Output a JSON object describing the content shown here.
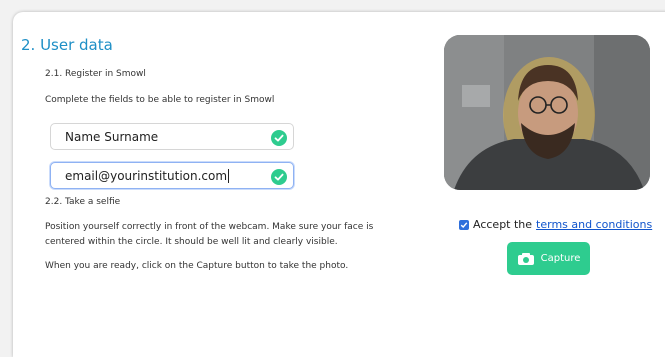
{
  "section": {
    "title": "2. User data"
  },
  "register": {
    "subtitle": "2.1. Register in Smowl",
    "instruction": "Complete the fields to be able to register in Smowl",
    "name_value": "Name Surname",
    "email_value": "email@yourinstitution.com"
  },
  "selfie": {
    "subtitle": "2.2. Take a selfie",
    "line1": "Position yourself correctly in front of the webcam. Make sure your face is",
    "line2": "centered within the circle. It should be well lit and clearly visible.",
    "ready_text": "When you are ready, click on the Capture button to take the photo."
  },
  "consent": {
    "checked": true,
    "prefix": "Accept the",
    "link_text": "terms and conditions"
  },
  "capture_button": {
    "label": "Capture"
  },
  "colors": {
    "accent_title": "#1e8fc6",
    "success_green": "#2ecc8f",
    "link_blue": "#1155cc"
  },
  "icons": {
    "field_valid": "check-circle-icon",
    "capture": "camera-icon",
    "checkbox": "checkbox-checked-icon"
  }
}
